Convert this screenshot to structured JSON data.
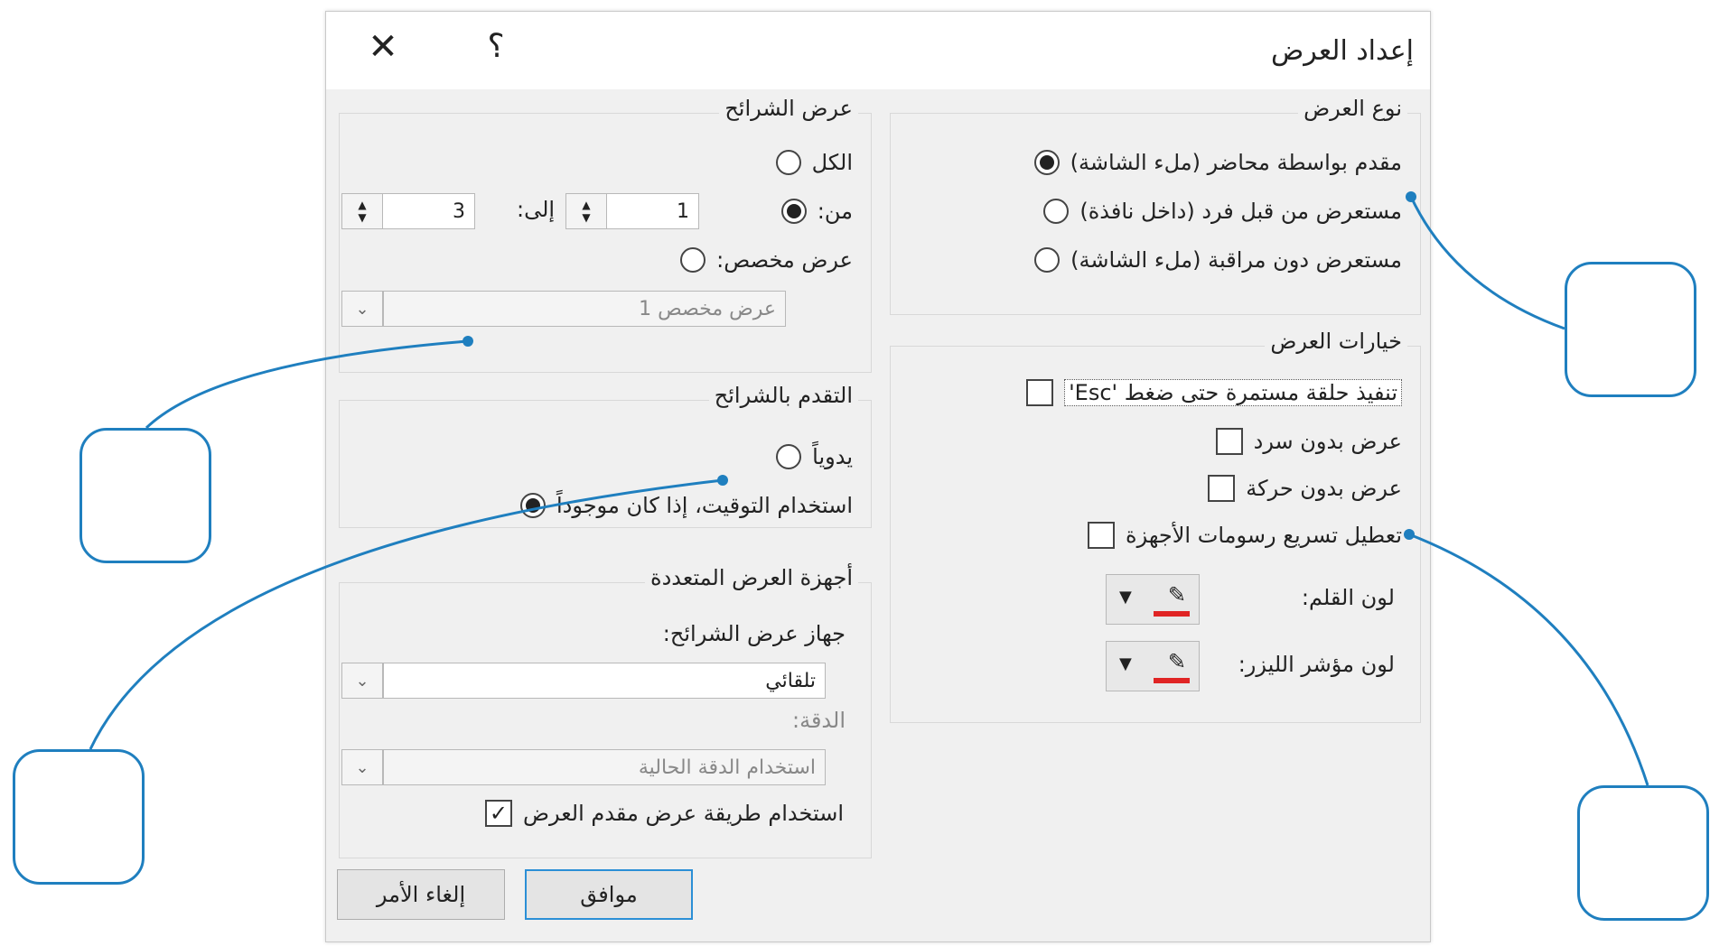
{
  "dialog": {
    "title": "إعداد العرض",
    "help_label": "؟",
    "close_label": "✕"
  },
  "show_type": {
    "legend": "نوع العرض",
    "options": [
      {
        "label": "مقدم بواسطة محاضر (ملء الشاشة)",
        "selected": true
      },
      {
        "label": "مستعرض من قبل فرد (داخل نافذة)",
        "selected": false
      },
      {
        "label": "مستعرض دون مراقبة (ملء الشاشة)",
        "selected": false
      }
    ]
  },
  "show_options": {
    "legend": "خيارات العرض",
    "checkboxes": [
      {
        "label": "تنفيذ حلقة مستمرة حتى ضغط 'Esc'",
        "checked": false
      },
      {
        "label": "عرض بدون سرد",
        "checked": false
      },
      {
        "label": "عرض بدون حركة",
        "checked": false
      },
      {
        "label": "تعطيل تسريع رسومات الأجهزة",
        "checked": false
      }
    ],
    "pen_color_label": "لون القلم:",
    "laser_color_label": "لون مؤشر الليزر:",
    "pen_color": "#e02424",
    "laser_color": "#e02424"
  },
  "show_slides": {
    "legend": "عرض الشرائح",
    "all_label": "الكل",
    "from_label": "من:",
    "to_label": "إلى:",
    "from_value": "1",
    "to_value": "3",
    "custom_label": "عرض مخصص:",
    "custom_value": "عرض مخصص 1",
    "selected": "from"
  },
  "advance_slides": {
    "legend": "التقدم بالشرائح",
    "options": [
      {
        "label": "يدوياً",
        "selected": false
      },
      {
        "label": "استخدام التوقيت، إذا كان موجوداً",
        "selected": true
      }
    ]
  },
  "multiple_monitors": {
    "legend": "أجهزة العرض المتعددة",
    "monitor_label": "جهاز عرض الشرائح:",
    "monitor_value": "تلقائي",
    "resolution_label": "الدقة:",
    "resolution_value": "استخدام الدقة الحالية",
    "presenter_view_label": "استخدام طريقة عرض مقدم العرض",
    "presenter_view_checked": true,
    "check_mark": "✓"
  },
  "buttons": {
    "ok": "موافق",
    "cancel": "إلغاء الأمر"
  },
  "icons": {
    "pen": "✎",
    "dropdown": "▼",
    "dropdown_small": "⌄",
    "spin_up": "▲",
    "spin_down": "▼"
  },
  "accent_color": "#1f7fbf"
}
